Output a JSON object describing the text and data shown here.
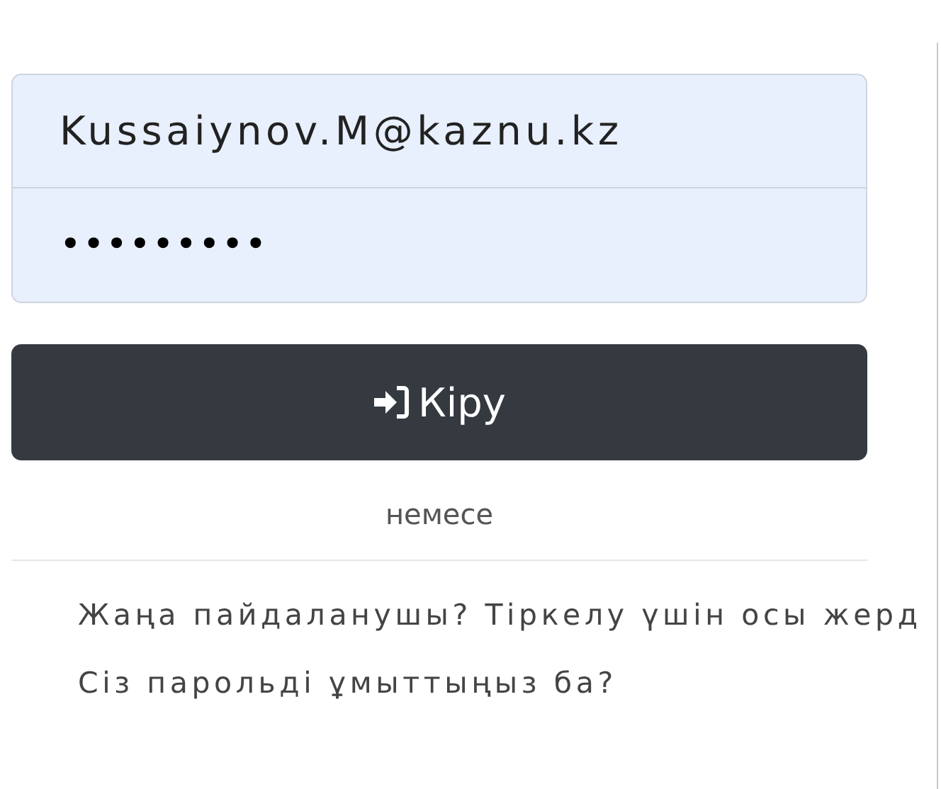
{
  "login_form": {
    "fields": [
      {
        "kind": "email",
        "value": "Kussaiynov.M@kaznu.kz"
      },
      {
        "kind": "password",
        "value": "•••••••••"
      }
    ],
    "submit_button": {
      "label": "Кіру"
    },
    "separator": "немесе",
    "links": [
      "Жаңа пайдаланушы? Тіркелу үшін осы жерд",
      "Сіз парольді ұмыттыңыз ба?"
    ]
  }
}
